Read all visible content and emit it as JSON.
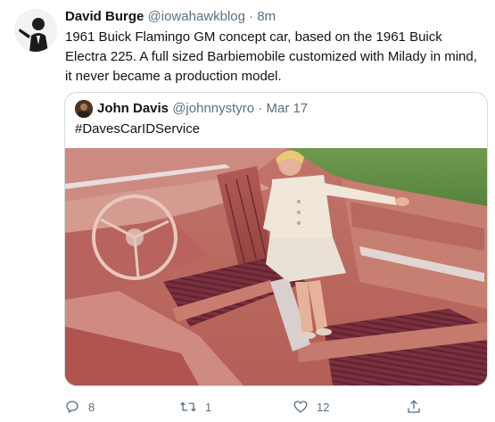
{
  "tweet": {
    "author": {
      "display_name": "David Burge",
      "handle": "@iowahawkblog",
      "separator": "·",
      "time": "8m"
    },
    "text": "1961 Buick Flamingo GM concept car, based on the 1961 Buick Electra 225. A full sized Barbiemobile customized with Milady in mind, it never became a production model.",
    "quoted": {
      "display_name": "John Davis",
      "handle": "@johnnystyro",
      "separator": "·",
      "time": "Mar 17",
      "text": "#DavesCarIDService",
      "media_icon": "photo-convertible-interior"
    },
    "actions": {
      "reply_count": "8",
      "retweet_count": "1",
      "like_count": "12",
      "reply_icon": "reply-icon",
      "retweet_icon": "retweet-icon",
      "like_icon": "heart-icon",
      "share_icon": "share-icon"
    }
  }
}
